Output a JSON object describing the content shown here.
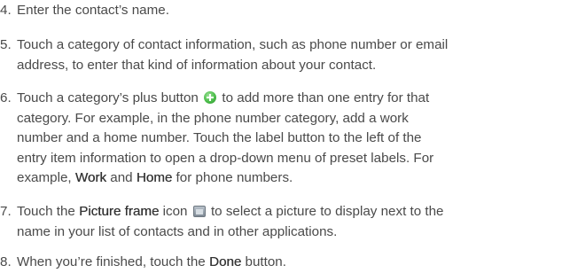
{
  "steps": [
    {
      "number": "4.",
      "lines": [
        {
          "text": "Enter the contact’s name."
        }
      ]
    },
    {
      "number": "5.",
      "lines": [
        {
          "text": "Touch a category of contact information, such as phone number or email"
        },
        {
          "text": "address, to enter that kind of information about your contact."
        }
      ]
    },
    {
      "number": "6.",
      "line1_before_icon": "Touch a category’s plus button",
      "line1_after_icon": "to add more than one entry for that",
      "plus_icon": "plus-icon",
      "lines_rest": [
        "category. For example, in the phone number category, add a work",
        "number and a home number. Touch the label button to the left of the",
        "entry item information to open a drop-down menu of preset labels. For"
      ],
      "line5_before": "example, ",
      "line5_bold1": "Work",
      "line5_mid": " and ",
      "line5_bold2": "Home",
      "line5_after": " for phone numbers."
    },
    {
      "number": "7.",
      "line1_before": "Touch the ",
      "line1_bold": "Picture frame",
      "line1_mid": " icon",
      "frame_icon": "picture-frame-icon",
      "line1_after": "to select a picture to display next to the",
      "line2": "name in your list of contacts and in other applications."
    },
    {
      "number": "8.",
      "line1_before": "When you’re finished, touch the ",
      "line1_bold": "Done",
      "line1_after": " button."
    }
  ],
  "colors": {
    "text": "#4a4a4a",
    "emphasis": "#333333",
    "plus_icon": "#4bbd4a"
  }
}
